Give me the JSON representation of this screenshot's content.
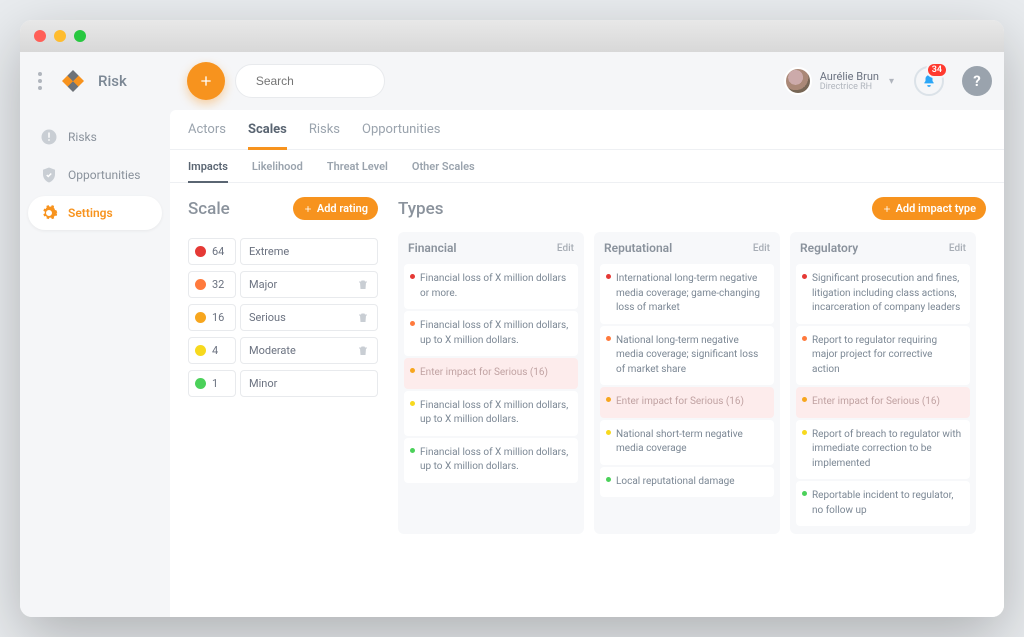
{
  "app": {
    "name": "Risk"
  },
  "search": {
    "placeholder": "Search"
  },
  "user": {
    "name": "Aurélie Brun",
    "role": "Directrice RH"
  },
  "notifications": {
    "count": "34"
  },
  "sidebar": {
    "items": [
      {
        "label": "Risks"
      },
      {
        "label": "Opportunities"
      },
      {
        "label": "Settings"
      }
    ]
  },
  "tabs": [
    {
      "label": "Actors"
    },
    {
      "label": "Scales"
    },
    {
      "label": "Risks"
    },
    {
      "label": "Opportunities"
    }
  ],
  "subtabs": [
    {
      "label": "Impacts"
    },
    {
      "label": "Likelihood"
    },
    {
      "label": "Threat Level"
    },
    {
      "label": "Other Scales"
    }
  ],
  "scale": {
    "heading": "Scale",
    "add_label": "Add rating",
    "rows": [
      {
        "value": "64",
        "label": "Extreme",
        "color": "#e53935",
        "deletable": false
      },
      {
        "value": "32",
        "label": "Major",
        "color": "#ff7a3d",
        "deletable": true
      },
      {
        "value": "16",
        "label": "Serious",
        "color": "#f7a61e",
        "deletable": true
      },
      {
        "value": "4",
        "label": "Moderate",
        "color": "#f7d91e",
        "deletable": true
      },
      {
        "value": "1",
        "label": "Minor",
        "color": "#4bd15a",
        "deletable": false
      }
    ]
  },
  "types": {
    "heading": "Types",
    "add_label": "Add impact type",
    "edit_label": "Edit",
    "empty_placeholder": "Enter impact for Serious (16)",
    "columns": [
      {
        "title": "Financial",
        "impacts": [
          {
            "color": "#e53935",
            "text": "Financial loss of X million dollars or more."
          },
          {
            "color": "#ff7a3d",
            "text": "Financial loss of X million dollars, up to X million dollars."
          },
          {
            "color": "#f7a61e",
            "text": "",
            "empty": true
          },
          {
            "color": "#f7d91e",
            "text": "Financial loss of X million dollars, up to X million dollars."
          },
          {
            "color": "#4bd15a",
            "text": "Financial loss of X million dollars, up to X million dollars."
          }
        ]
      },
      {
        "title": "Reputational",
        "impacts": [
          {
            "color": "#e53935",
            "text": "International long-term negative media coverage; game-changing loss of market"
          },
          {
            "color": "#ff7a3d",
            "text": "National long-term negative media coverage; significant loss of market share"
          },
          {
            "color": "#f7a61e",
            "text": "",
            "empty": true
          },
          {
            "color": "#f7d91e",
            "text": "National short-term negative media coverage"
          },
          {
            "color": "#4bd15a",
            "text": "Local reputational damage"
          }
        ]
      },
      {
        "title": "Regulatory",
        "impacts": [
          {
            "color": "#e53935",
            "text": "Significant prosecution and fines, litigation including class actions, incarceration of company leaders"
          },
          {
            "color": "#ff7a3d",
            "text": "Report to regulator requiring major project for corrective action"
          },
          {
            "color": "#f7a61e",
            "text": "",
            "empty": true
          },
          {
            "color": "#f7d91e",
            "text": "Report of breach to regulator with immediate correction to be implemented"
          },
          {
            "color": "#4bd15a",
            "text": "Reportable incident to regulator, no follow up"
          }
        ]
      }
    ]
  }
}
